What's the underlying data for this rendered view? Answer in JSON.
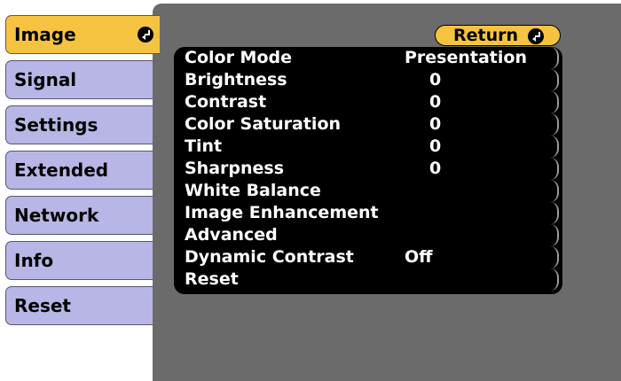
{
  "tabs": [
    {
      "label": "Image",
      "active": true
    },
    {
      "label": "Signal",
      "active": false
    },
    {
      "label": "Settings",
      "active": false
    },
    {
      "label": "Extended",
      "active": false
    },
    {
      "label": "Network",
      "active": false
    },
    {
      "label": "Info",
      "active": false
    },
    {
      "label": "Reset",
      "active": false
    }
  ],
  "return_label": "Return",
  "icons": {
    "enter": "enter-icon"
  },
  "menu": [
    {
      "label": "Color Mode",
      "value": "Presentation"
    },
    {
      "label": "Brightness",
      "value": "0"
    },
    {
      "label": "Contrast",
      "value": "0"
    },
    {
      "label": "Color Saturation",
      "value": "0"
    },
    {
      "label": "Tint",
      "value": "0"
    },
    {
      "label": "Sharpness",
      "value": "0"
    },
    {
      "label": "White Balance",
      "value": ""
    },
    {
      "label": "Image Enhancement",
      "value": ""
    },
    {
      "label": "Advanced",
      "value": ""
    },
    {
      "label": "Dynamic Contrast",
      "value": "Off"
    },
    {
      "label": "Reset",
      "value": ""
    }
  ],
  "colors": {
    "active_tab": "#f5c33f",
    "inactive_tab": "#b8b6e6",
    "panel": "#6b6b6b",
    "list_background": "#000000",
    "text_on_list": "#ffffff"
  }
}
